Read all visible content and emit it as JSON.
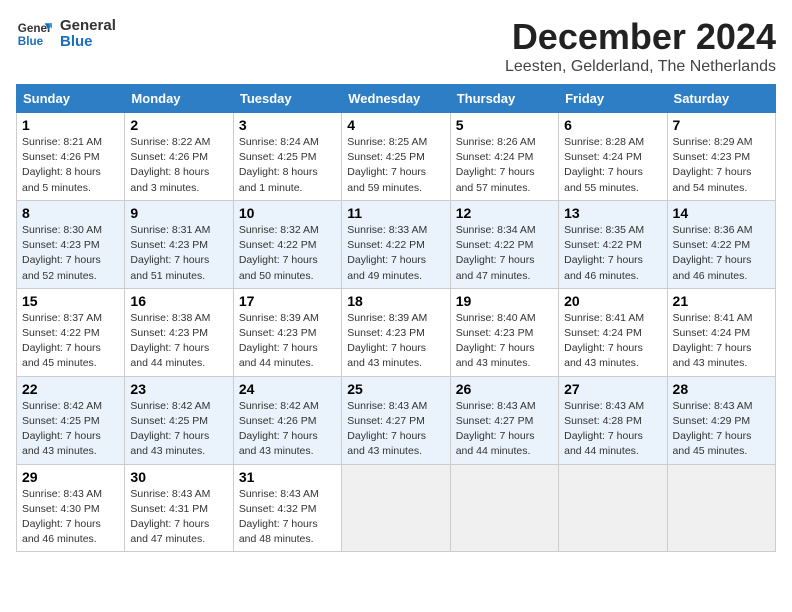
{
  "header": {
    "logo_line1": "General",
    "logo_line2": "Blue",
    "month_title": "December 2024",
    "location": "Leesten, Gelderland, The Netherlands"
  },
  "weekdays": [
    "Sunday",
    "Monday",
    "Tuesday",
    "Wednesday",
    "Thursday",
    "Friday",
    "Saturday"
  ],
  "weeks": [
    [
      {
        "day": 1,
        "sunrise": "8:21 AM",
        "sunset": "4:26 PM",
        "daylight": "8 hours and 5 minutes."
      },
      {
        "day": 2,
        "sunrise": "8:22 AM",
        "sunset": "4:26 PM",
        "daylight": "8 hours and 3 minutes."
      },
      {
        "day": 3,
        "sunrise": "8:24 AM",
        "sunset": "4:25 PM",
        "daylight": "8 hours and 1 minute."
      },
      {
        "day": 4,
        "sunrise": "8:25 AM",
        "sunset": "4:25 PM",
        "daylight": "7 hours and 59 minutes."
      },
      {
        "day": 5,
        "sunrise": "8:26 AM",
        "sunset": "4:24 PM",
        "daylight": "7 hours and 57 minutes."
      },
      {
        "day": 6,
        "sunrise": "8:28 AM",
        "sunset": "4:24 PM",
        "daylight": "7 hours and 55 minutes."
      },
      {
        "day": 7,
        "sunrise": "8:29 AM",
        "sunset": "4:23 PM",
        "daylight": "7 hours and 54 minutes."
      }
    ],
    [
      {
        "day": 8,
        "sunrise": "8:30 AM",
        "sunset": "4:23 PM",
        "daylight": "7 hours and 52 minutes."
      },
      {
        "day": 9,
        "sunrise": "8:31 AM",
        "sunset": "4:23 PM",
        "daylight": "7 hours and 51 minutes."
      },
      {
        "day": 10,
        "sunrise": "8:32 AM",
        "sunset": "4:22 PM",
        "daylight": "7 hours and 50 minutes."
      },
      {
        "day": 11,
        "sunrise": "8:33 AM",
        "sunset": "4:22 PM",
        "daylight": "7 hours and 49 minutes."
      },
      {
        "day": 12,
        "sunrise": "8:34 AM",
        "sunset": "4:22 PM",
        "daylight": "7 hours and 47 minutes."
      },
      {
        "day": 13,
        "sunrise": "8:35 AM",
        "sunset": "4:22 PM",
        "daylight": "7 hours and 46 minutes."
      },
      {
        "day": 14,
        "sunrise": "8:36 AM",
        "sunset": "4:22 PM",
        "daylight": "7 hours and 46 minutes."
      }
    ],
    [
      {
        "day": 15,
        "sunrise": "8:37 AM",
        "sunset": "4:22 PM",
        "daylight": "7 hours and 45 minutes."
      },
      {
        "day": 16,
        "sunrise": "8:38 AM",
        "sunset": "4:23 PM",
        "daylight": "7 hours and 44 minutes."
      },
      {
        "day": 17,
        "sunrise": "8:39 AM",
        "sunset": "4:23 PM",
        "daylight": "7 hours and 44 minutes."
      },
      {
        "day": 18,
        "sunrise": "8:39 AM",
        "sunset": "4:23 PM",
        "daylight": "7 hours and 43 minutes."
      },
      {
        "day": 19,
        "sunrise": "8:40 AM",
        "sunset": "4:23 PM",
        "daylight": "7 hours and 43 minutes."
      },
      {
        "day": 20,
        "sunrise": "8:41 AM",
        "sunset": "4:24 PM",
        "daylight": "7 hours and 43 minutes."
      },
      {
        "day": 21,
        "sunrise": "8:41 AM",
        "sunset": "4:24 PM",
        "daylight": "7 hours and 43 minutes."
      }
    ],
    [
      {
        "day": 22,
        "sunrise": "8:42 AM",
        "sunset": "4:25 PM",
        "daylight": "7 hours and 43 minutes."
      },
      {
        "day": 23,
        "sunrise": "8:42 AM",
        "sunset": "4:25 PM",
        "daylight": "7 hours and 43 minutes."
      },
      {
        "day": 24,
        "sunrise": "8:42 AM",
        "sunset": "4:26 PM",
        "daylight": "7 hours and 43 minutes."
      },
      {
        "day": 25,
        "sunrise": "8:43 AM",
        "sunset": "4:27 PM",
        "daylight": "7 hours and 43 minutes."
      },
      {
        "day": 26,
        "sunrise": "8:43 AM",
        "sunset": "4:27 PM",
        "daylight": "7 hours and 44 minutes."
      },
      {
        "day": 27,
        "sunrise": "8:43 AM",
        "sunset": "4:28 PM",
        "daylight": "7 hours and 44 minutes."
      },
      {
        "day": 28,
        "sunrise": "8:43 AM",
        "sunset": "4:29 PM",
        "daylight": "7 hours and 45 minutes."
      }
    ],
    [
      {
        "day": 29,
        "sunrise": "8:43 AM",
        "sunset": "4:30 PM",
        "daylight": "7 hours and 46 minutes."
      },
      {
        "day": 30,
        "sunrise": "8:43 AM",
        "sunset": "4:31 PM",
        "daylight": "7 hours and 47 minutes."
      },
      {
        "day": 31,
        "sunrise": "8:43 AM",
        "sunset": "4:32 PM",
        "daylight": "7 hours and 48 minutes."
      },
      null,
      null,
      null,
      null
    ]
  ],
  "labels": {
    "sunrise": "Sunrise:",
    "sunset": "Sunset:",
    "daylight": "Daylight:"
  }
}
